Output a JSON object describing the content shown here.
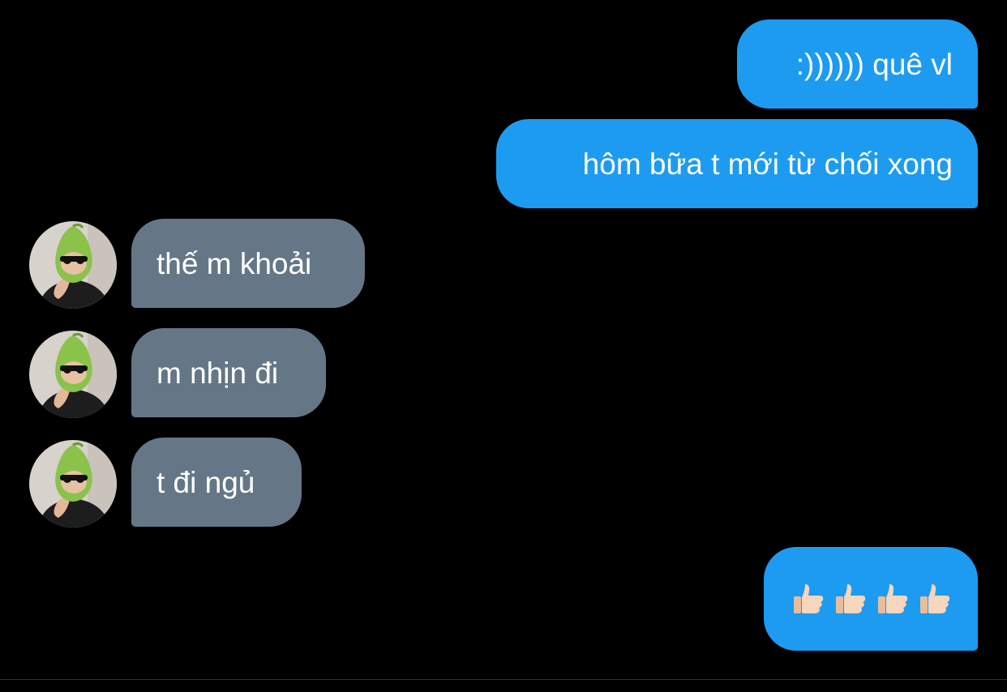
{
  "messages": [
    {
      "direction": "outgoing",
      "text": ":)))))) quê vl"
    },
    {
      "direction": "outgoing",
      "text": "hôm bữa t mới từ chối xong"
    },
    {
      "direction": "incoming",
      "text": "thế m khoải",
      "avatar": "avatar-icon"
    },
    {
      "direction": "incoming",
      "text": "m nhịn đi",
      "avatar": "avatar-icon"
    },
    {
      "direction": "incoming",
      "text": "t đi ngủ",
      "avatar": "avatar-icon"
    },
    {
      "direction": "outgoing",
      "emoji": [
        "thumbs-up-icon",
        "thumbs-up-icon",
        "thumbs-up-icon",
        "thumbs-up-icon"
      ]
    }
  ],
  "colors": {
    "background": "#000000",
    "outgoing_bubble": "#1d9bf0",
    "incoming_bubble": "#657786",
    "text": "#ffffff"
  }
}
